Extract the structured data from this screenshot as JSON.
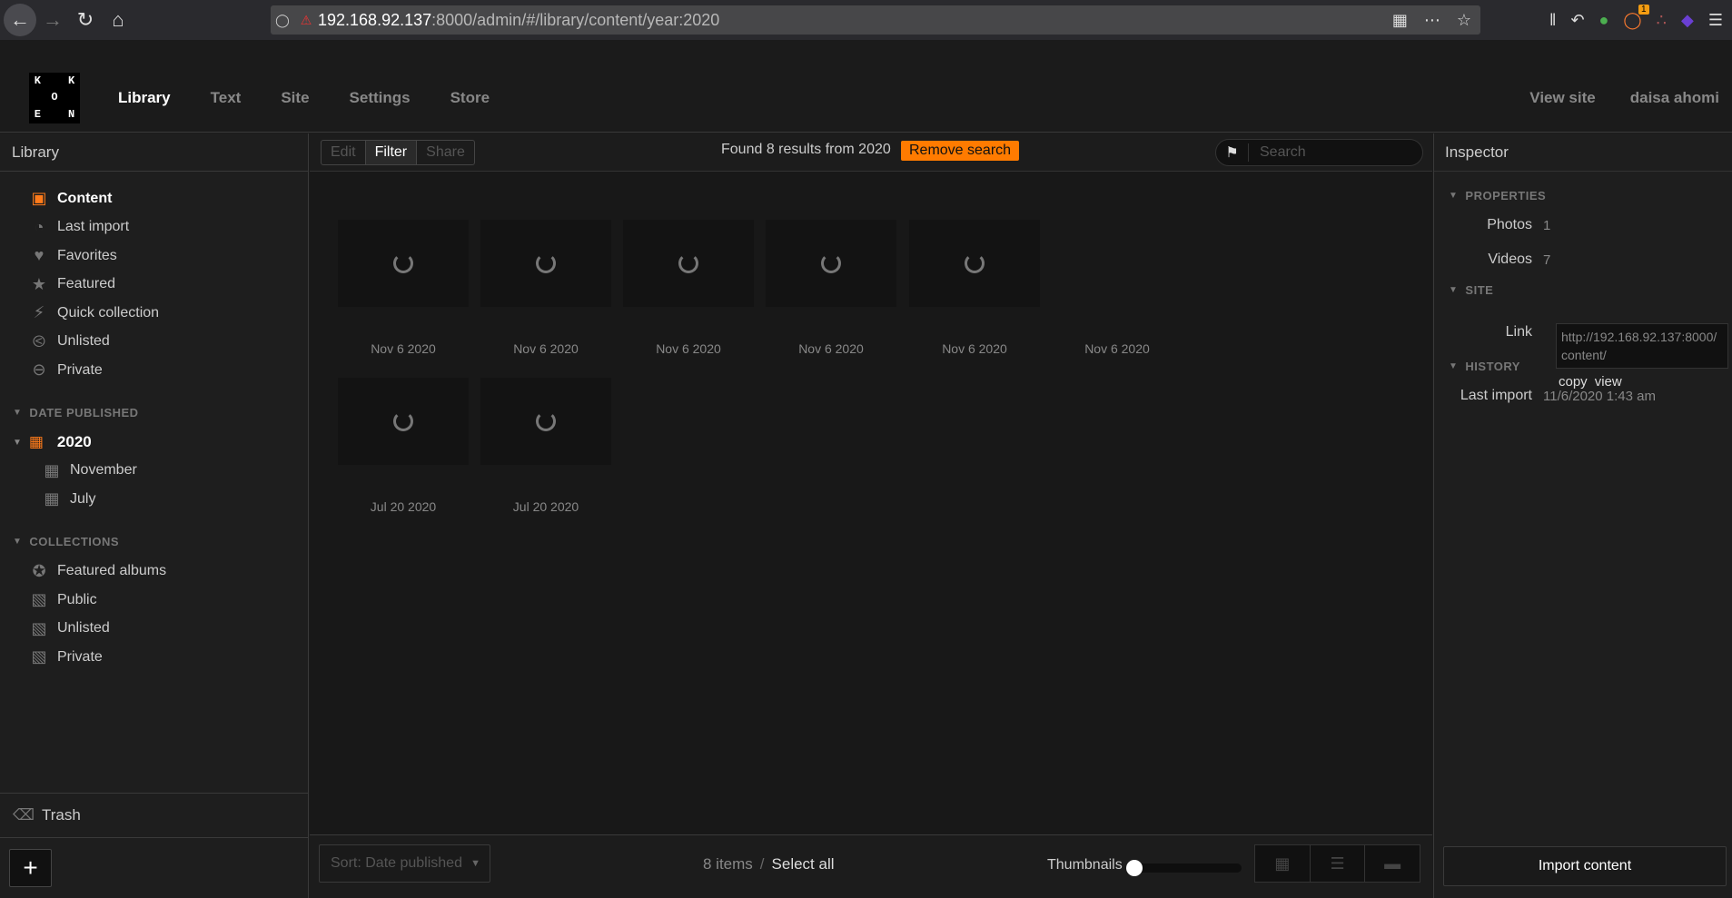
{
  "browser": {
    "url_host": "192.168.92.137",
    "url_path": ":8000/admin/#/library/content/year:2020",
    "badge_count": "1"
  },
  "header": {
    "logo_letters": [
      "K",
      "",
      "K",
      "",
      "O",
      "",
      "E",
      "",
      "N"
    ],
    "nav": [
      "Library",
      "Text",
      "Site",
      "Settings",
      "Store"
    ],
    "view_site": "View site",
    "user": "daisa ahomi"
  },
  "sidebar": {
    "title": "Library",
    "items": [
      "Content",
      "Last import",
      "Favorites",
      "Featured",
      "Quick collection",
      "Unlisted",
      "Private"
    ],
    "date_section": "DATE PUBLISHED",
    "year": "2020",
    "months": [
      "November",
      "July"
    ],
    "collections_section": "COLLECTIONS",
    "collections": [
      "Featured albums",
      "Public",
      "Unlisted",
      "Private"
    ],
    "trash": "Trash",
    "add": "+"
  },
  "toolbar": {
    "edit": "Edit",
    "filter": "Filter",
    "share": "Share",
    "result_text": "Found 8 results from 2020",
    "remove_search": "Remove search",
    "search_placeholder": "Search"
  },
  "items": [
    {
      "date": "Nov 6 2020"
    },
    {
      "date": "Nov 6 2020"
    },
    {
      "date": "Nov 6 2020"
    },
    {
      "date": "Nov 6 2020"
    },
    {
      "date": "Nov 6 2020"
    },
    {
      "date": "Nov 6 2020"
    },
    {
      "date": "Jul 20 2020"
    },
    {
      "date": "Jul 20 2020"
    }
  ],
  "bottombar": {
    "sort": "Sort: Date published",
    "count": "8 items",
    "sep": "/",
    "select_all": "Select all",
    "thumbnails": "Thumbnails"
  },
  "inspector": {
    "title": "Inspector",
    "properties": "PROPERTIES",
    "photos_label": "Photos",
    "photos_value": "1",
    "videos_label": "Videos",
    "videos_value": "7",
    "site": "SITE",
    "link_label": "Link",
    "link_value": "http://192.168.92.137:8000/content/",
    "copy": "copy",
    "view": "view",
    "history": "HISTORY",
    "last_import_label": "Last import",
    "last_import_value": "11/6/2020 1:43 am",
    "import_button": "Import content"
  },
  "colors": {
    "accent": "#ff7b00",
    "background": "#181818"
  }
}
